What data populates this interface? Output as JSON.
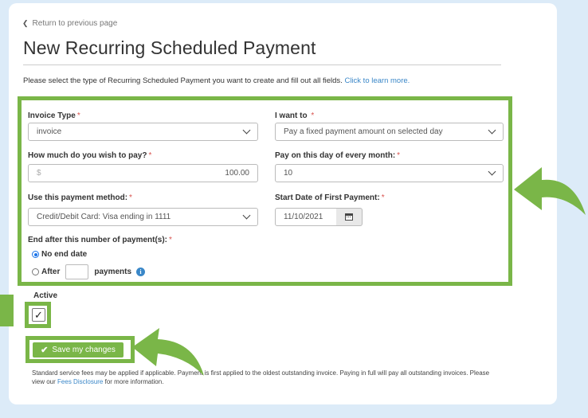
{
  "nav": {
    "back_label": "Return to previous page",
    "back_icon": "chevron-left-icon"
  },
  "page": {
    "title": "New Recurring Scheduled Payment"
  },
  "intro": {
    "text": "Please select the type of Recurring Scheduled Payment you want to create and fill out all fields.",
    "link": "Click to learn more."
  },
  "form": {
    "invoice_type": {
      "label": "Invoice Type",
      "value": "invoice"
    },
    "i_want_to": {
      "label": "I want to",
      "value": "Pay a fixed payment amount on selected day"
    },
    "amount": {
      "label": "How much do you wish to pay?",
      "currency": "$",
      "value": "100.00"
    },
    "pay_day": {
      "label": "Pay on this day of every month:",
      "value": "10"
    },
    "payment_method": {
      "label": "Use this payment method:",
      "value": "Credit/Debit Card: Visa ending in 1111"
    },
    "start_date": {
      "label": "Start Date of First Payment:",
      "value": "11/10/2021"
    },
    "end_after": {
      "label": "End after this number of payment(s):",
      "option_no_end": "No end date",
      "option_after": "After",
      "option_after_suffix": "payments",
      "selected": "No end date"
    },
    "required_mark": "*"
  },
  "active": {
    "label": "Active",
    "checked": true,
    "check_glyph": "✓"
  },
  "actions": {
    "save_label": "Save my changes",
    "save_icon": "✔"
  },
  "footer": {
    "text_before": "Standard service fees may be applied if applicable. Payment is first applied to the oldest outstanding invoice. Paying in full will pay all outstanding invoices. Please view our",
    "link": "Fees Disclosure",
    "text_after": "for more information."
  },
  "colors": {
    "background": "#dcebf8",
    "highlight_green": "#7ab648",
    "link_blue": "#3a87c8",
    "required_red": "#d9534f"
  },
  "info_glyph": "i"
}
